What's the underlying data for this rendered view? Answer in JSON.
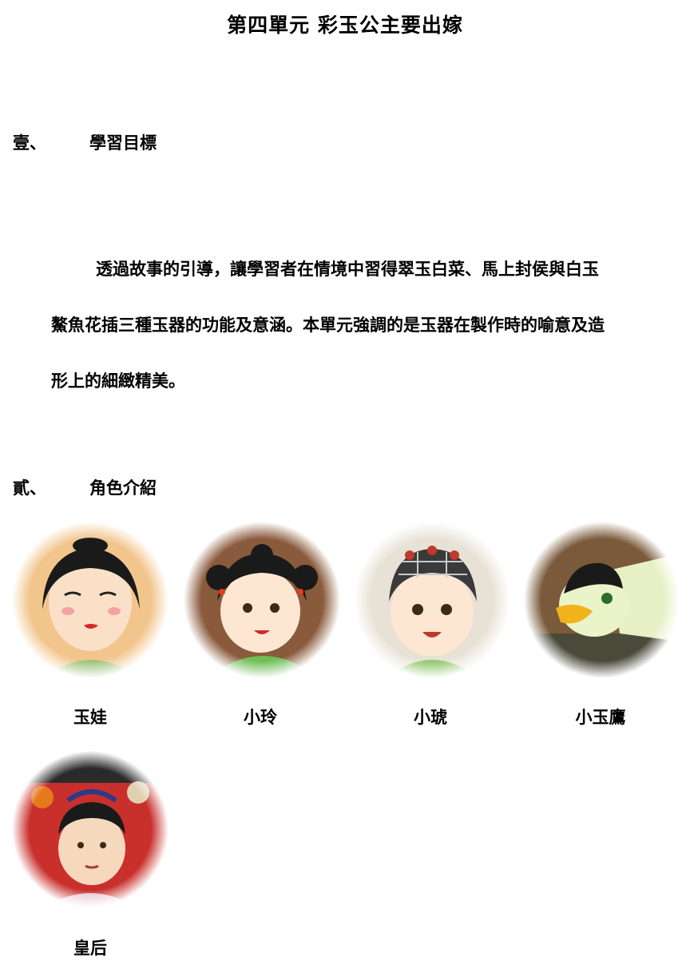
{
  "document": {
    "title": "第四單元 彩玉公主要出嫁",
    "sections": [
      {
        "number": "壹、",
        "heading": "學習目標"
      },
      {
        "number": "貳、",
        "heading": "角色介紹"
      }
    ],
    "objective_lines": [
      "透過故事的引導，讓學習者在情境中習得翠玉白菜、馬上封侯與白玉",
      "鰲魚花插三種玉器的功能及意涵。本單元強調的是玉器在製作時的喻意及造",
      "形上的細緻精美。"
    ],
    "characters": [
      {
        "name": "玉娃",
        "icon": "yuwa-portrait"
      },
      {
        "name": "小玲",
        "icon": "xiaoling-portrait"
      },
      {
        "name": "小琥",
        "icon": "xiaohu-portrait"
      },
      {
        "name": "小玉鷹",
        "icon": "eagle-portrait"
      },
      {
        "name": "皇后",
        "icon": "empress-portrait"
      }
    ]
  }
}
